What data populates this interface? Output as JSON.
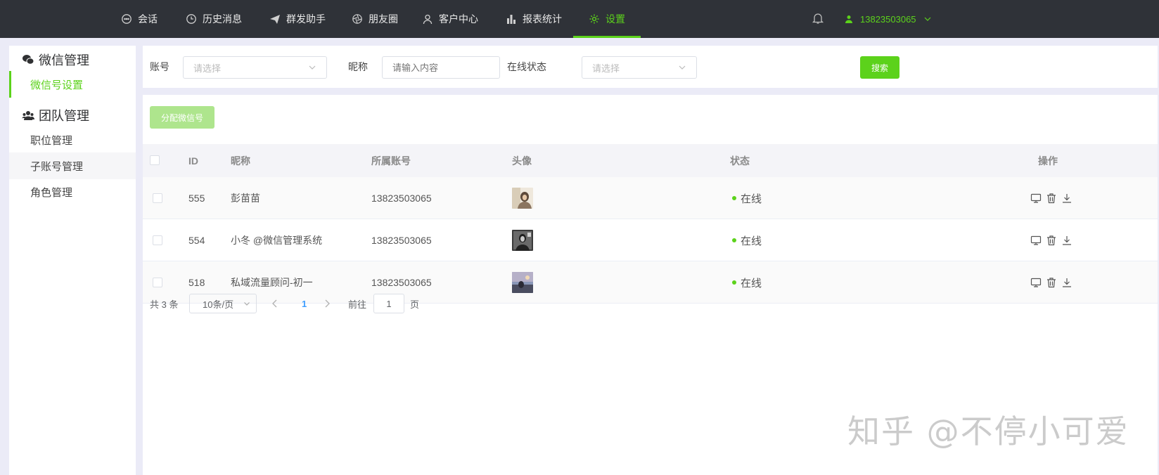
{
  "topnav": {
    "items": [
      {
        "label": "会话",
        "icon": "chat-icon"
      },
      {
        "label": "历史消息",
        "icon": "clock-icon"
      },
      {
        "label": "群发助手",
        "icon": "send-icon"
      },
      {
        "label": "朋友圈",
        "icon": "aperture-icon"
      },
      {
        "label": "客户中心",
        "icon": "user-icon"
      },
      {
        "label": "报表统计",
        "icon": "bar-chart-icon"
      },
      {
        "label": "设置",
        "icon": "gear-icon",
        "active": true
      }
    ],
    "user": "13823503065",
    "accent": "#5cd21b",
    "bg": "#2f3238"
  },
  "sidebar": {
    "groups": [
      {
        "title": "微信管理",
        "icon": "wechat-icon",
        "items": [
          {
            "label": "微信号设置",
            "active": true
          }
        ]
      },
      {
        "title": "团队管理",
        "icon": "team-icon",
        "items": [
          {
            "label": "职位管理"
          },
          {
            "label": "子账号管理"
          },
          {
            "label": "角色管理"
          }
        ]
      }
    ]
  },
  "filter": {
    "account_label": "账号",
    "account_placeholder": "请选择",
    "nickname_label": "昵称",
    "nickname_placeholder": "请输入内容",
    "status_label": "在线状态",
    "status_placeholder": "请选择",
    "search_button": "搜索"
  },
  "main": {
    "assign_button": "分配微信号",
    "columns": [
      "ID",
      "昵称",
      "所属账号",
      "头像",
      "状态",
      "操作"
    ],
    "rows": [
      {
        "id": "555",
        "nickname": "彭苗苗",
        "account": "13823503065",
        "status": "在线"
      },
      {
        "id": "554",
        "nickname": "小冬 @微信管理系统",
        "account": "13823503065",
        "status": "在线"
      },
      {
        "id": "518",
        "nickname": "私域流量顾问-初一",
        "account": "13823503065",
        "status": "在线"
      }
    ]
  },
  "pagination": {
    "total": "共 3 条",
    "page_size": "10条/页",
    "current_page": "1",
    "goto_label": "前往",
    "goto_value": "1",
    "page_suffix": "页"
  },
  "watermark": "知乎 @不停小可爱"
}
